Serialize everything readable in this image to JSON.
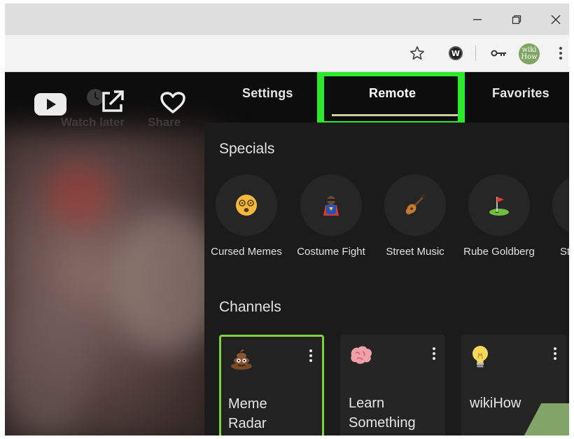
{
  "window": {
    "minimize_glyph": "—",
    "close_glyph": "✕"
  },
  "toolbar": {
    "icons": [
      "star-icon",
      "extension-w-icon",
      "key-icon",
      "profile-avatar",
      "chrome-menu-icon"
    ],
    "extension_letter": "W",
    "avatar_line1": "wiki",
    "avatar_line2": "How"
  },
  "video_overlay": {
    "watch_later_label": "Watch later",
    "share_label": "Share",
    "icons": [
      "youtube-icon",
      "clock-icon",
      "external-share-icon",
      "heart-icon"
    ]
  },
  "tabs": [
    {
      "label": "Settings",
      "active": false
    },
    {
      "label": "Remote",
      "active": true
    },
    {
      "label": "Favorites",
      "active": false
    }
  ],
  "highlight_color": "#2bea2a",
  "specials": {
    "title": "Specials",
    "items": [
      {
        "label": "Cursed Memes",
        "icon": "dizzy-face-icon"
      },
      {
        "label": "Costume Fight",
        "icon": "superhero-icon"
      },
      {
        "label": "Street Music",
        "icon": "guitar-icon"
      },
      {
        "label": "Rube Goldberg",
        "icon": "golf-flag-icon"
      },
      {
        "label": "Ste",
        "icon": "partial-icon"
      }
    ]
  },
  "channels": {
    "title": "Channels",
    "items": [
      {
        "name": "Meme\nRadar",
        "icon": "poop-icon",
        "selected": true
      },
      {
        "name": "Learn\nSomething",
        "icon": "brain-icon",
        "selected": false
      },
      {
        "name": "wikiHow",
        "icon": "lightbulb-icon",
        "selected": false
      }
    ]
  }
}
